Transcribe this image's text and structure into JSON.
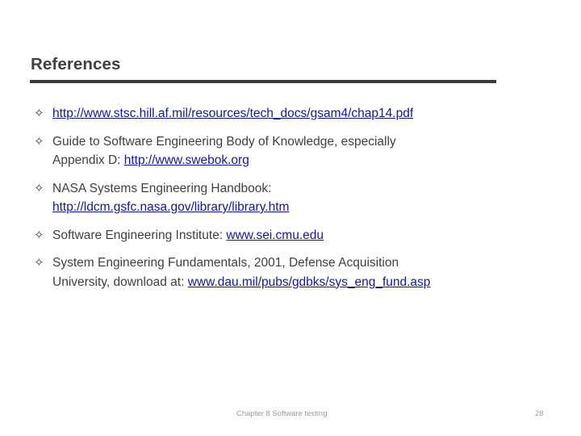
{
  "slide": {
    "title": "References",
    "bullet_glyph": "✧",
    "colors": {
      "text": "#3f3f44",
      "link": "#16169c",
      "rule": "#3b3b3f",
      "footer": "#9b9b9b",
      "background": "#ffffff"
    },
    "bullets": [
      {
        "id": "stsc-hill-gsam",
        "lines": [
          [
            {
              "type": "link",
              "text": "http://www.stsc.hill.af.mil/resources/tech_docs/gsam4/chap14.pdf"
            }
          ]
        ]
      },
      {
        "id": "swebok-guide",
        "lines": [
          [
            {
              "type": "plain",
              "text": "Guide to Software Engineering Body of Knowledge, especially"
            }
          ],
          [
            {
              "type": "plain",
              "text": "Appendix D: "
            },
            {
              "type": "link",
              "text": "http://www.swebok.org"
            }
          ]
        ]
      },
      {
        "id": "nasa-systems-engineering-handbook",
        "lines": [
          [
            {
              "type": "plain",
              "text": "NASA Systems Engineering Handbook:"
            }
          ],
          [
            {
              "type": "link",
              "text": "http://ldcm.gsfc.nasa.gov/library/library.htm"
            }
          ]
        ]
      },
      {
        "id": "software-engineering-institute",
        "lines": [
          [
            {
              "type": "plain",
              "text": "Software Engineering Institute: "
            },
            {
              "type": "link",
              "text": "www.sei.cmu.edu"
            }
          ]
        ]
      },
      {
        "id": "system-engineering-fundamentals",
        "lines": [
          [
            {
              "type": "plain",
              "text": "System Engineering Fundamentals, 2001, Defense Acquisition"
            }
          ],
          [
            {
              "type": "plain",
              "text": "University, download at: "
            },
            {
              "type": "link",
              "text": "www.dau.mil/pubs/gdbks/sys_eng_fund.asp"
            }
          ]
        ]
      }
    ],
    "footer": {
      "text": "Chapter 8 Software testing",
      "page_number": "28"
    }
  }
}
